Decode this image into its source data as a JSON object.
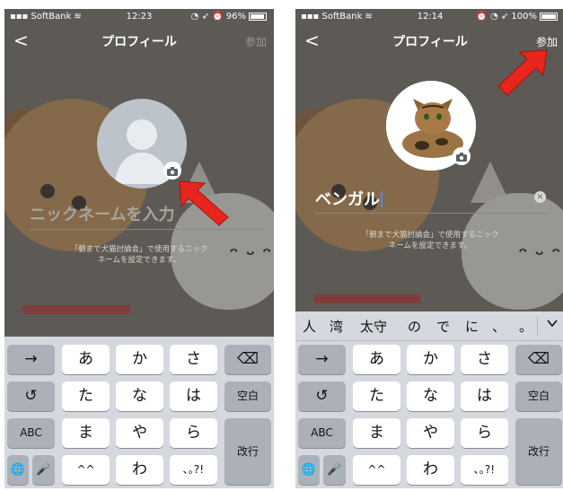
{
  "left": {
    "status": {
      "carrier": "SoftBank",
      "time": "12:23",
      "battery": "96%",
      "battery_level": 0.96
    },
    "nav": {
      "back": "<",
      "title": "プロフィール",
      "join": "参加"
    },
    "name_input": {
      "placeholder": "ニックネームを入力"
    },
    "hint": {
      "line1": "「朝まで犬猫討論会」で使用するニック",
      "line2": "ネームを設定できます。"
    },
    "keyboard": {
      "r1": [
        "→",
        "あ",
        "か",
        "さ",
        "⌫"
      ],
      "r2": [
        "↺",
        "た",
        "な",
        "は",
        "空白"
      ],
      "r3": [
        "ABC",
        "ま",
        "や",
        "ら",
        "改行"
      ],
      "r4": [
        "🌐",
        "🎤",
        "^^",
        "わ",
        "､｡?!"
      ]
    }
  },
  "right": {
    "status": {
      "carrier": "SoftBank",
      "time": "12:14",
      "battery": "100%",
      "battery_level": 1.0
    },
    "nav": {
      "back": "<",
      "title": "プロフィール",
      "join": "参加"
    },
    "name_input": {
      "value": "ベンガル"
    },
    "hint": {
      "line1": "「朝まで犬猫討論会」で使用するニック",
      "line2": "ネームを設定できます。"
    },
    "suggestions": [
      "人",
      "湾",
      "太守",
      "の",
      "で",
      "に",
      "、",
      "。"
    ],
    "keyboard": {
      "r1": [
        "→",
        "あ",
        "か",
        "さ",
        "⌫"
      ],
      "r2": [
        "↺",
        "た",
        "な",
        "は",
        "空白"
      ],
      "r3": [
        "ABC",
        "ま",
        "や",
        "ら",
        "改行"
      ],
      "r4": [
        "🌐",
        "🎤",
        "^^",
        "わ",
        "､｡?!"
      ]
    }
  },
  "icons": {
    "camera": "camera-icon",
    "arrow": "red-arrow-icon",
    "globe": "globe-icon",
    "mic": "microphone-icon",
    "backspace": "backspace-icon",
    "chevron": "chevron-down-icon",
    "wifi": "wifi-icon",
    "battery": "battery-icon"
  },
  "colors": {
    "accent_arrow": "#e8261e",
    "caret": "#4a8af0",
    "keyboard_bg": "#d5d8de"
  }
}
